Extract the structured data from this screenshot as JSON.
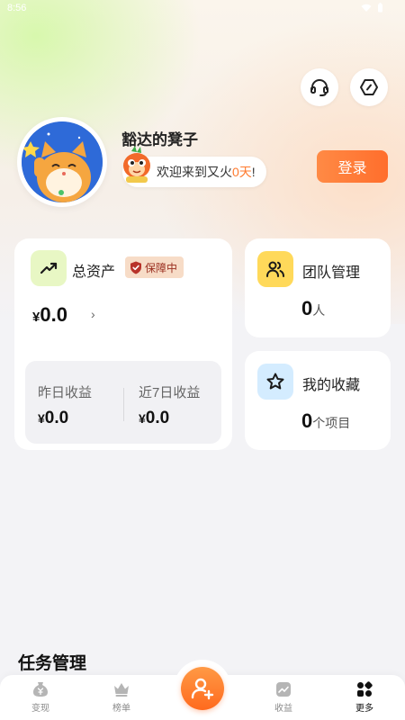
{
  "status_bar": {
    "time": "8:56"
  },
  "top_actions": {
    "support_icon": "headset-icon",
    "settings_icon": "hexagon-settings-icon"
  },
  "profile": {
    "username": "豁达的凳子",
    "welcome_prefix": "欢迎来到又火",
    "welcome_days": "0天",
    "welcome_suffix": "!",
    "login_label": "登录"
  },
  "assets": {
    "title": "总资产",
    "badge": "保障中",
    "currency": "¥",
    "amount": "0.0",
    "arrow": "›",
    "yesterday_label": "昨日收益",
    "yesterday_value": "0.0",
    "week_label": "近7日收益",
    "week_value": "0.0"
  },
  "team": {
    "title": "团队管理",
    "count": "0",
    "unit": "人"
  },
  "favorites": {
    "title": "我的收藏",
    "count": "0",
    "unit": "个项目"
  },
  "tasks": {
    "title": "任务管理"
  },
  "bottom_nav": {
    "items": [
      {
        "label": "变现",
        "icon": "yen-bag-icon"
      },
      {
        "label": "榜单",
        "icon": "crown-icon"
      },
      {
        "label": "收益",
        "icon": "trend-chart-icon"
      },
      {
        "label": "更多",
        "icon": "grid-more-icon"
      }
    ],
    "active": "更多",
    "center_icon": "add-user-icon"
  },
  "colors": {
    "accent": "#ff7a2e",
    "badge_bg": "#f7dcc7",
    "team_icon_bg": "#ffd95a",
    "fav_icon_bg": "#d4ecff",
    "assets_icon_bg": "#e8f7c4"
  }
}
